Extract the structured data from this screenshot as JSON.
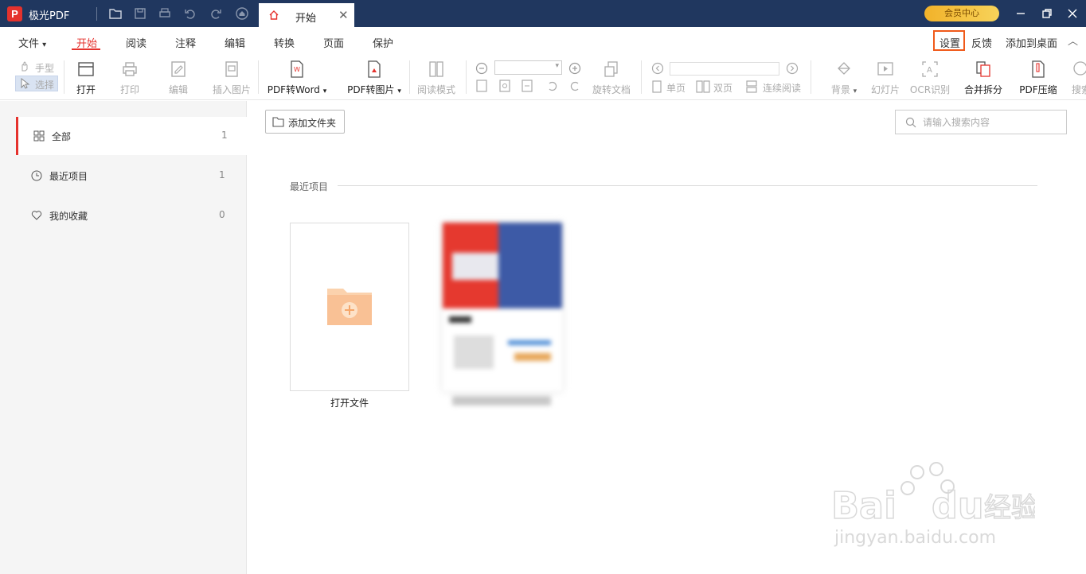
{
  "app": {
    "name": "极光PDF",
    "logo_letter": "P"
  },
  "titlebar": {
    "tab_label": "开始",
    "tab_close": "✕",
    "vip_label": "会员中心"
  },
  "menu": {
    "items": [
      "文件",
      "开始",
      "阅读",
      "注释",
      "编辑",
      "转换",
      "页面",
      "保护"
    ],
    "file_arrow": "▾",
    "right": {
      "settings": "设置",
      "feedback": "反馈",
      "add_desktop": "添加到桌面",
      "collapse": "︿"
    }
  },
  "toolbar": {
    "hand": "手型",
    "select": "选择",
    "open": "打开",
    "print": "打印",
    "edit": "编辑",
    "insert_image": "插入图片",
    "pdf_to_word": "PDF转Word",
    "pdf_to_image": "PDF转图片",
    "reading_mode": "阅读模式",
    "rotate": "旋转文档",
    "single": "单页",
    "double": "双页",
    "continuous": "连续阅读",
    "background": "背景",
    "slideshow": "幻灯片",
    "ocr": "OCR识别",
    "merge_split": "合并拆分",
    "compress": "PDF压缩",
    "search_cut": "搜索",
    "dropdown": "▾"
  },
  "sidebar": {
    "items": [
      {
        "label": "全部",
        "count": "1",
        "icon": "grid-icon"
      },
      {
        "label": "最近项目",
        "count": "1",
        "icon": "clock-icon"
      },
      {
        "label": "我的收藏",
        "count": "0",
        "icon": "heart-icon"
      }
    ]
  },
  "main": {
    "add_folder": "添加文件夹",
    "search_placeholder": "请输入搜索内容",
    "section_title": "最近项目",
    "open_file": "打开文件"
  },
  "colors": {
    "accent": "#e5322d",
    "titlebar": "#20375f",
    "highlight": "#f05a1a"
  }
}
